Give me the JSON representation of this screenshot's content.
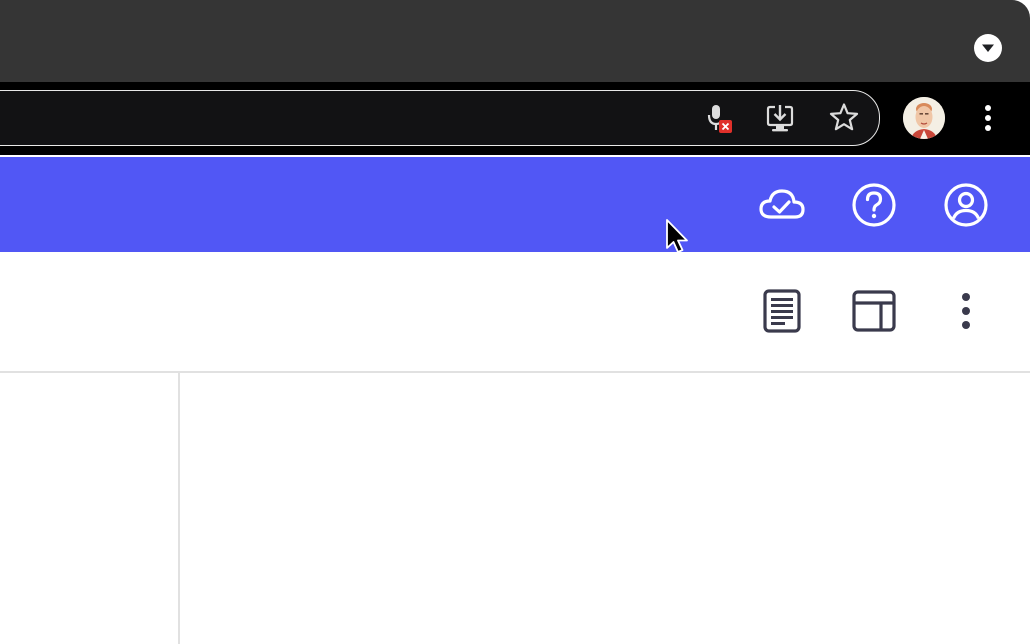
{
  "browser": {
    "tab_strip": {
      "tab_search_icon": "chevron-down-icon"
    },
    "toolbar": {
      "omnibox_icons": [
        {
          "name": "microphone-blocked-icon",
          "status": "blocked",
          "badge_color": "#e0302a"
        },
        {
          "name": "install-app-icon"
        },
        {
          "name": "bookmark-star-icon"
        }
      ],
      "profile_avatar": "profile-avatar",
      "menu_icon": "more-vertical-icon"
    }
  },
  "app": {
    "colors": {
      "header_background": "#5157f5",
      "icon_on_header": "#ffffff",
      "toolbar_icon": "#3a3a4c",
      "divider": "#e1e1e1"
    },
    "header": {
      "actions": [
        {
          "name": "cloud-check-icon",
          "meaning": "saved to cloud"
        },
        {
          "name": "help-circle-icon"
        },
        {
          "name": "account-circle-icon"
        }
      ]
    },
    "toolbar": {
      "actions": [
        {
          "name": "document-lines-icon"
        },
        {
          "name": "layout-panels-icon"
        },
        {
          "name": "more-vertical-icon"
        }
      ]
    }
  }
}
